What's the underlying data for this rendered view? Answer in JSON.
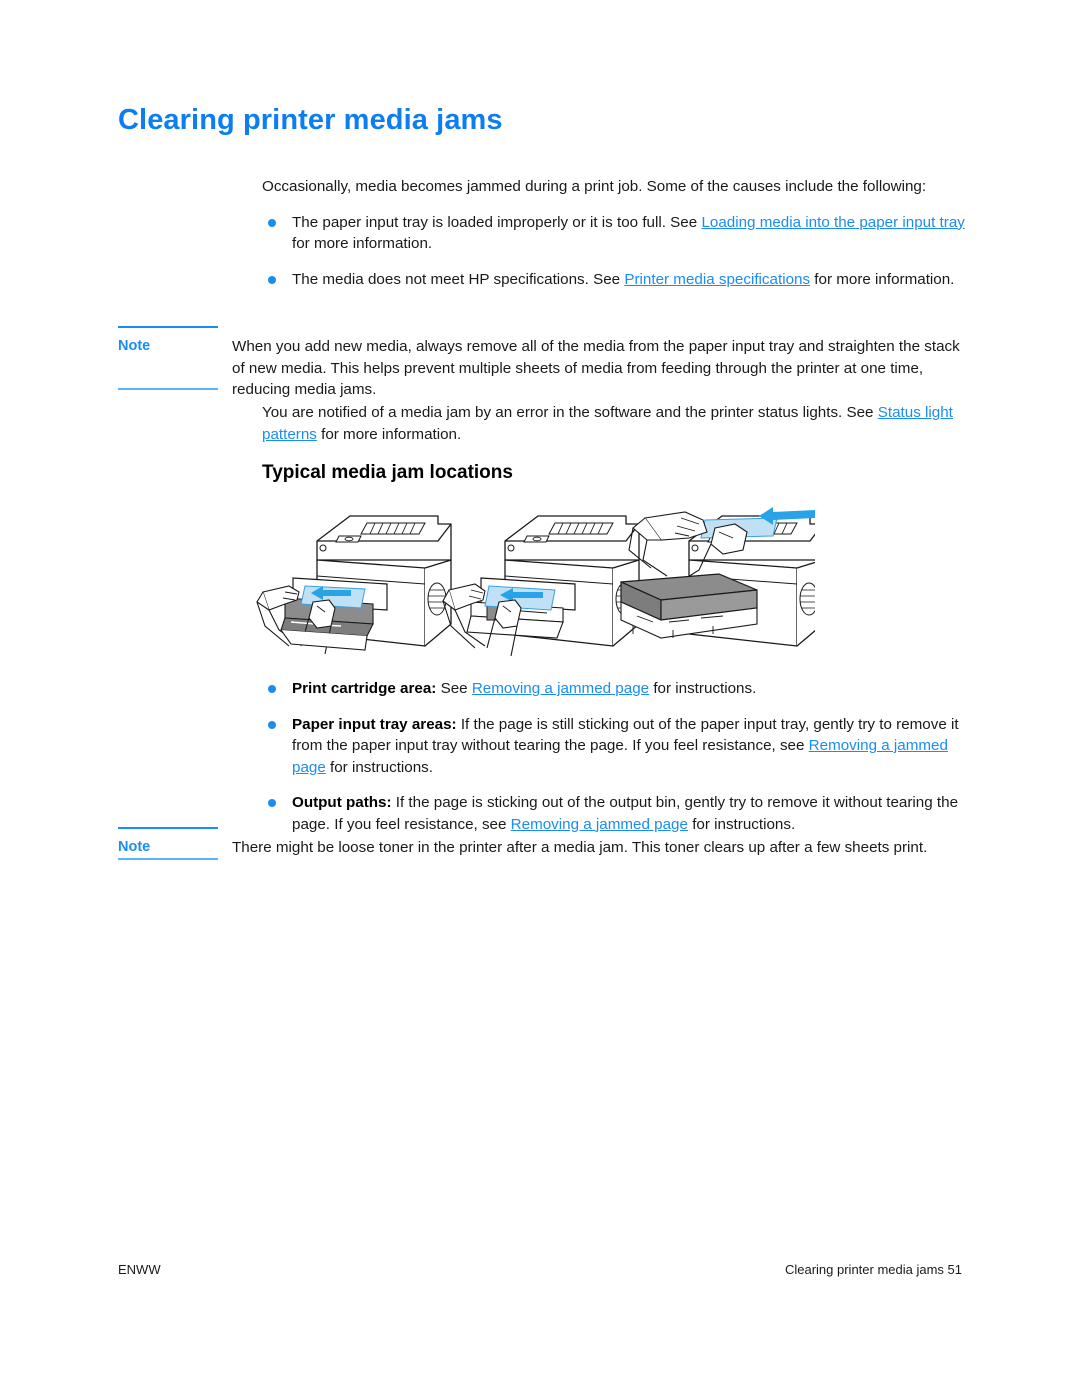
{
  "document": {
    "title": "Clearing printer media jams",
    "footer_left": "ENWW",
    "footer_right": "Clearing printer media jams 51"
  },
  "colors": {
    "title_blue": "#0d7ef2",
    "link_blue": "#1a8cf5",
    "rule_blue": "#1a8cf5",
    "rule_blue_light": "#5bb4f7",
    "paper_accent": "#bfe0f5",
    "arrow_blue": "#29a3e8",
    "cartridge_gray": "#8c8c8c",
    "body_text": "#1a1a1a"
  },
  "intro": {
    "paragraph": "Occasionally, media becomes jammed during a print job. Some of the causes include the following:"
  },
  "causes": [
    {
      "pre": "The paper input tray is loaded improperly or it is too full. See ",
      "link": "Loading media into the paper input tray",
      "post": " for more information."
    },
    {
      "pre": "The media does not meet HP specifications. See ",
      "link": "Printer media specifications",
      "post": " for more information."
    }
  ],
  "note_1": {
    "label": "Note",
    "text": "When you add new media, always remove all of the media from the paper input tray and straighten the stack of new media. This helps prevent multiple sheets of media from feeding through the printer at one time, reducing media jams."
  },
  "notified": {
    "pre": "You are notified of a media jam by an error in the software and the printer status lights. See ",
    "link": "Status light patterns",
    "post": " for more information."
  },
  "section": {
    "heading": "Typical media jam locations"
  },
  "figures": [
    {
      "caption_ref": "print-cartridge-area-illustration"
    },
    {
      "caption_ref": "paper-input-tray-illustration"
    },
    {
      "caption_ref": "output-path-illustration"
    }
  ],
  "jam_locations": [
    {
      "lead": "Print cartridge area:",
      "pre": " See ",
      "link": "Removing a jammed page",
      "post": " for instructions."
    },
    {
      "lead": "Paper input tray areas:",
      "pre": " If the page is still sticking out of the paper input tray, gently try to remove it from the paper input tray without tearing the page. If you feel resistance, see ",
      "link": "Removing a jammed page",
      "post": " for instructions."
    },
    {
      "lead": "Output paths:",
      "pre": " If the page is sticking out of the output bin, gently try to remove it without tearing the page. If you feel resistance, see ",
      "link": "Removing a jammed page",
      "post": " for instructions."
    }
  ],
  "note_2": {
    "label": "Note",
    "text": "There might be loose toner in the printer after a media jam. This toner clears up after a few sheets print."
  }
}
